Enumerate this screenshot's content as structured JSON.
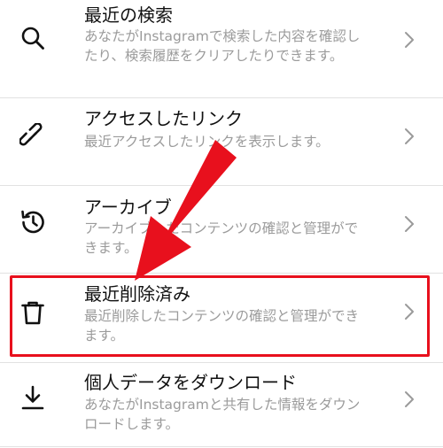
{
  "menu": {
    "items": [
      {
        "title": "最近の検索",
        "desc": "あなたがInstagramで検索した内容を確認したり、検索履歴をクリアしたりできます。",
        "icon": "search-icon"
      },
      {
        "title": "アクセスしたリンク",
        "desc": "最近アクセスしたリンクを表示します。",
        "icon": "link-icon"
      },
      {
        "title": "アーカイブ",
        "desc": "アーカイブしたコンテンツの確認と管理ができます。",
        "icon": "history-icon"
      },
      {
        "title": "最近削除済み",
        "desc": "最近削除したコンテンツの確認と管理ができます。",
        "icon": "trash-icon"
      },
      {
        "title": "個人データをダウンロード",
        "desc": "あなたがInstagramと共有した情報をダウンロードします。",
        "icon": "download-icon"
      }
    ]
  },
  "annotation": {
    "highlight_color": "#e8101d",
    "arrow_color": "#e8101d"
  }
}
